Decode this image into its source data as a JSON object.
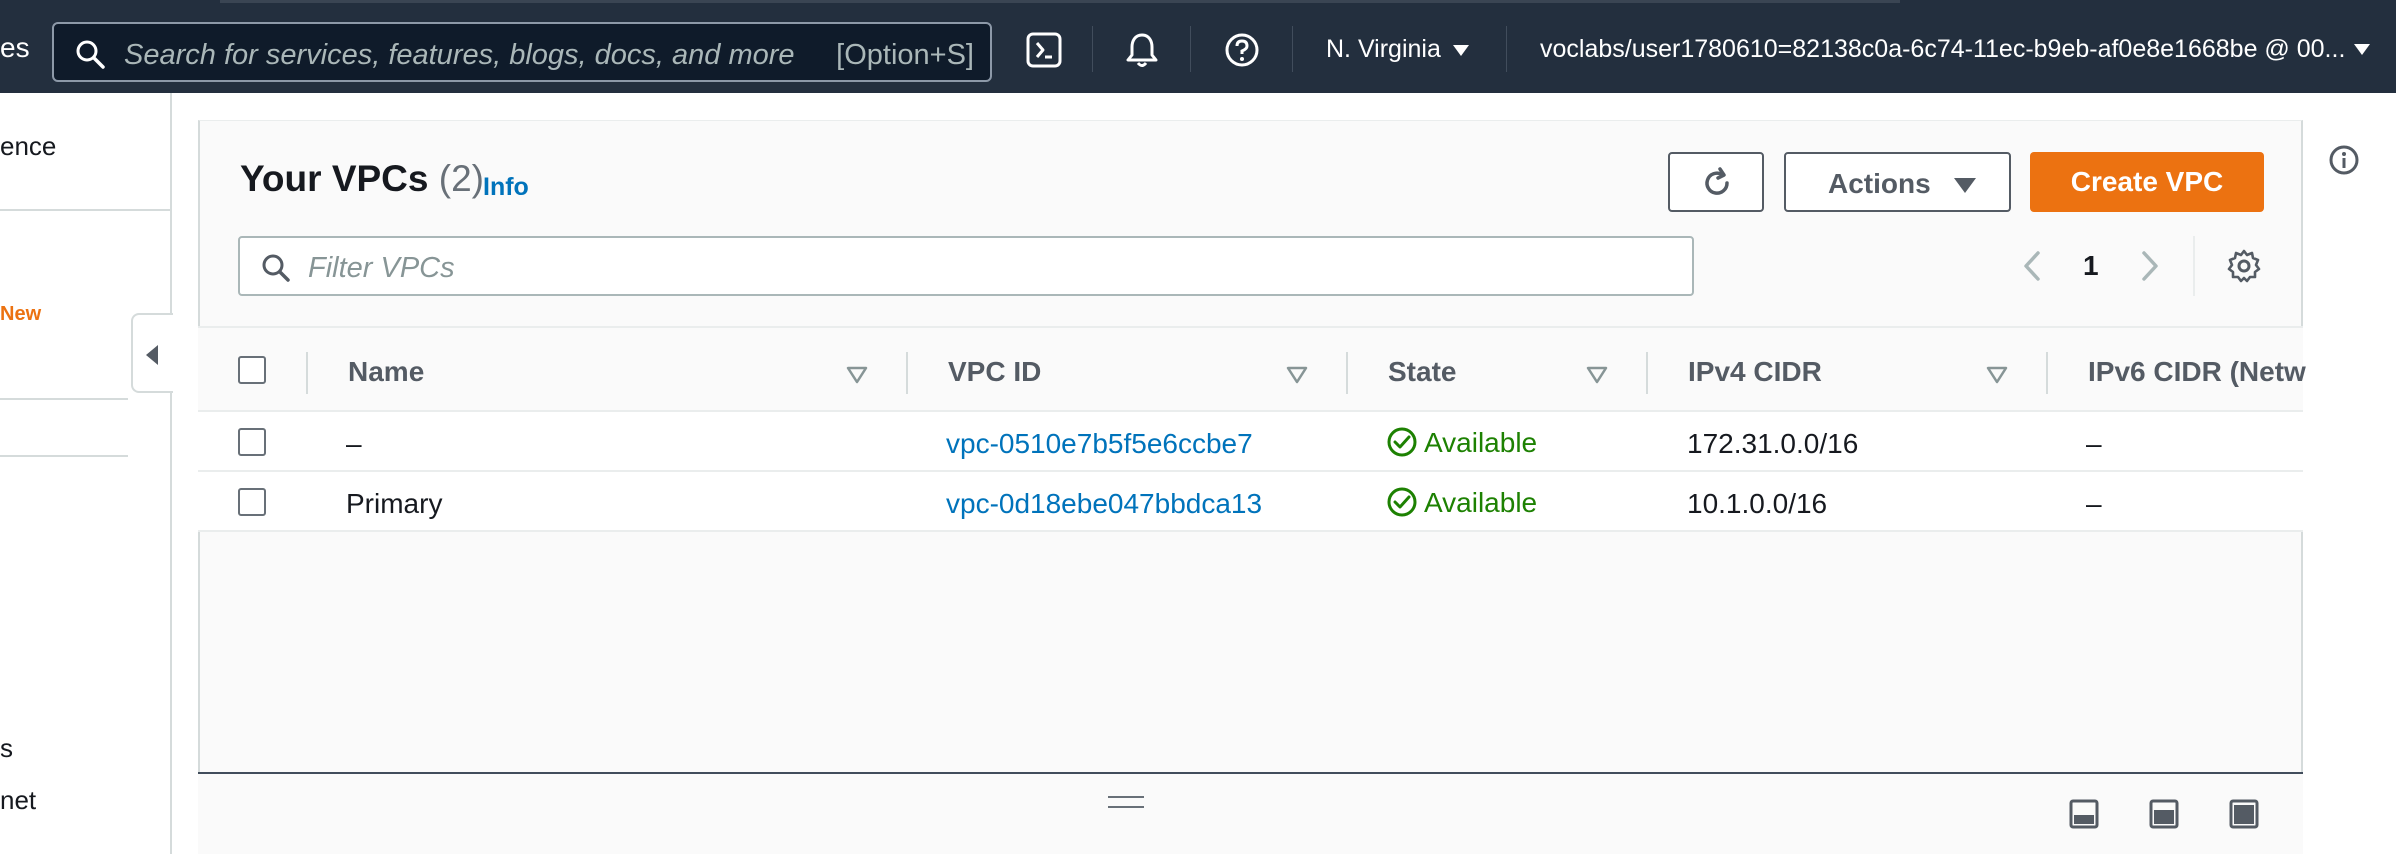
{
  "topnav": {
    "cut_label": "es",
    "search_placeholder": "Search for services, features, blogs, docs, and more",
    "search_shortcut": "[Option+S]",
    "region": "N. Virginia",
    "account": "voclabs/user1780610=82138c0a-6c74-11ec-b9eb-af0e8e1668be @ 00..."
  },
  "sidebar": {
    "item_top": "ence",
    "new_badge": "New",
    "item_bottom1": "s",
    "item_bottom2": "net"
  },
  "header": {
    "title": "Your VPCs",
    "count": "(2)",
    "info": "Info"
  },
  "toolbar": {
    "actions_label": "Actions",
    "create_label": "Create VPC",
    "filter_placeholder": "Filter VPCs",
    "page": "1"
  },
  "table": {
    "columns": [
      "Name",
      "VPC ID",
      "State",
      "IPv4 CIDR",
      "IPv6 CIDR (Netw"
    ],
    "rows": [
      {
        "name": "–",
        "vpc_id": "vpc-0510e7b5f5e6ccbe7",
        "state": "Available",
        "ipv4": "172.31.0.0/16",
        "ipv6": "–"
      },
      {
        "name": "Primary",
        "vpc_id": "vpc-0d18ebe047bbdca13",
        "state": "Available",
        "ipv4": "10.1.0.0/16",
        "ipv6": "–"
      }
    ]
  },
  "colors": {
    "nav_bg": "#232f3e",
    "accent": "#ec7211",
    "link": "#0073bb",
    "success": "#1d8102"
  }
}
